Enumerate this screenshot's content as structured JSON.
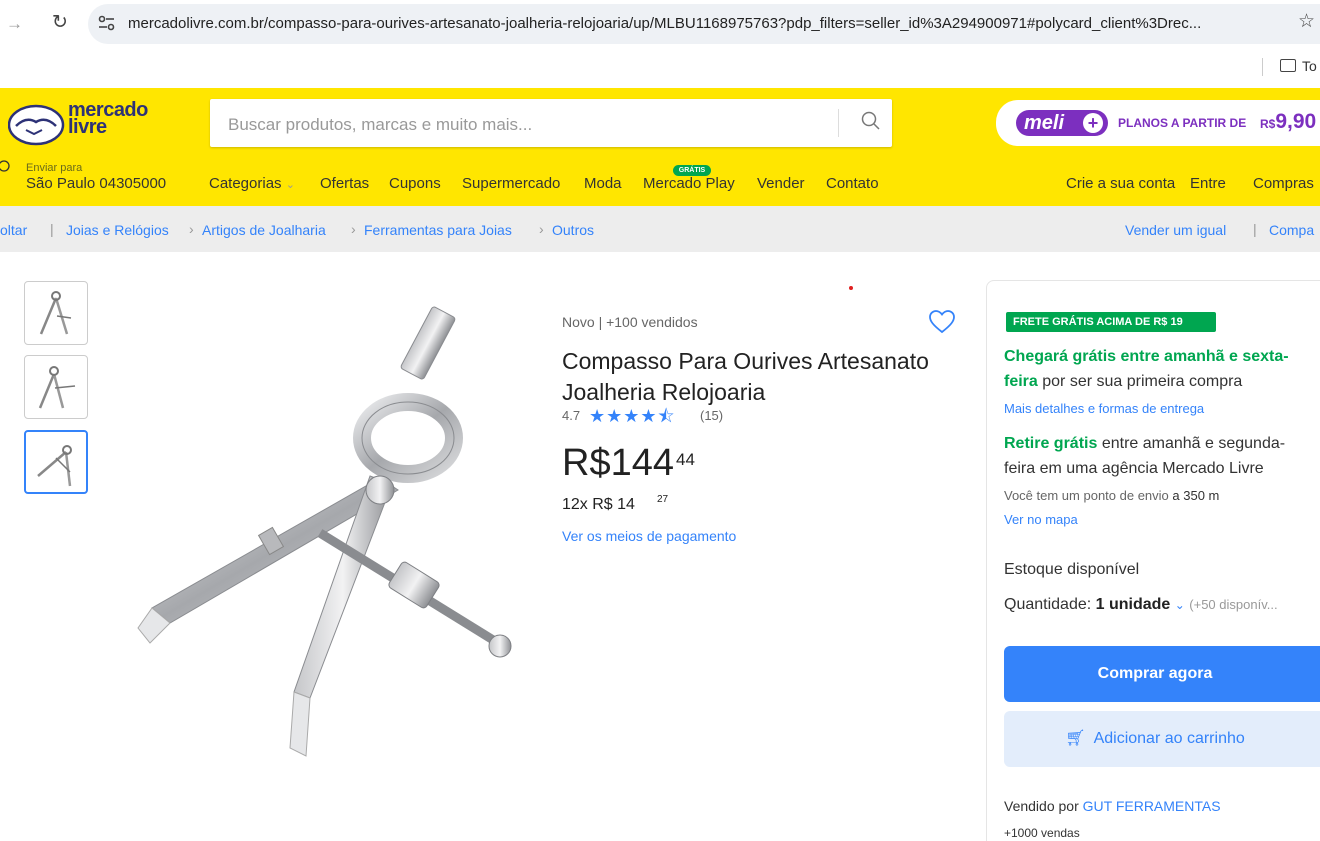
{
  "browser": {
    "url": "mercadolivre.com.br/compasso-para-ourives-artesanato-joalheria-relojoaria/up/MLBU1168975763?pdp_filters=seller_id%3A294900971#polycard_client%3Drec...",
    "bookmark_folder": "To"
  },
  "header": {
    "logo_line1": "mercado",
    "logo_line2": "livre",
    "search_placeholder": "Buscar produtos, marcas e muito mais...",
    "meli_badge": "meli",
    "meli_plans": "PLANOS A PARTIR DE",
    "meli_currency": "R$",
    "meli_price": "9,90",
    "location_label": "Enviar para",
    "location_value": "São Paulo 04305000",
    "nav": [
      "Categorias",
      "Ofertas",
      "Cupons",
      "Supermercado",
      "Moda",
      "Mercado Play",
      "Vender",
      "Contato"
    ],
    "gratis_badge": "GRÁTIS",
    "account": [
      "Crie a sua conta",
      "Entre",
      "Compras"
    ]
  },
  "breadcrumb": {
    "back": "oltar",
    "items": [
      "Joias e Relógios",
      "Artigos de Joalharia",
      "Ferramentas para Joias",
      "Outros"
    ],
    "sell_similar": "Vender um igual",
    "share": "Compa"
  },
  "product": {
    "condition": "Novo  |  +100 vendidos",
    "title": "Compasso Para Ourives Artesanato Joalheria Relojoaria",
    "rating": "4.7",
    "stars": "★★★★⯪",
    "rating_count": "(15)",
    "price": "R$144",
    "price_cents": "44",
    "installments": "12x R$ 14",
    "installment_cents": "27",
    "payment_link": "Ver os meios de pagamento"
  },
  "buybox": {
    "free_shipping": "FRETE GRÁTIS ACIMA DE R$ 19",
    "arrival_green": "Chegará grátis entre amanhã e sexta-",
    "arrival_green2": "feira",
    "arrival_rest": " por ser sua primeira compra",
    "more_details": "Mais detalhes e formas de entrega",
    "pickup_green": "Retire grátis",
    "pickup_rest": " entre amanhã e segunda-",
    "pickup_line2": "feira em uma agência Mercado Livre",
    "pickup_point": "Você tem um ponto de envio ",
    "pickup_distance": "a 350 m",
    "map_link": "Ver no mapa",
    "stock": "Estoque disponível",
    "qty_label": "Quantidade: ",
    "qty_value": "1 unidade",
    "qty_available": "(+50 disponív...",
    "buy_now": "Comprar agora",
    "add_cart": "Adicionar ao carrinho",
    "seller_prefix": "Vendido por ",
    "seller_name": "GUT FERRAMENTAS",
    "sales": "+1000 vendas"
  },
  "colors": {
    "header_yellow": "#ffe600",
    "link_blue": "#3483fa",
    "green": "#00a650",
    "meli_purple": "#7c2fbf"
  }
}
